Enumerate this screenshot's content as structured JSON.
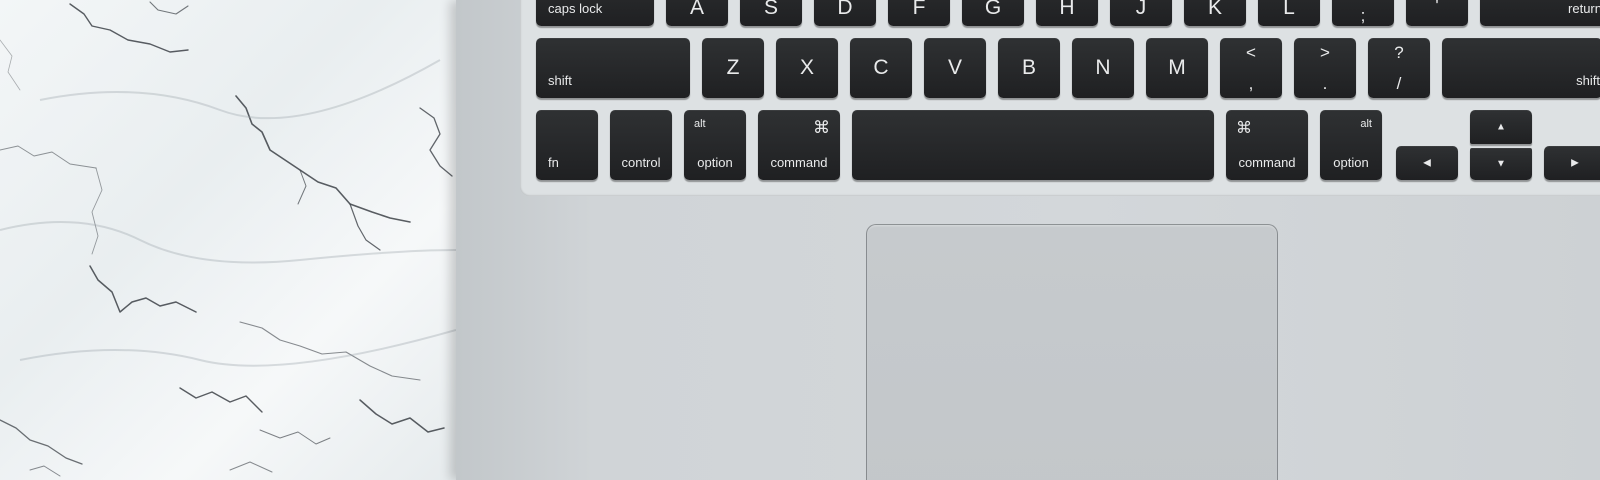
{
  "keyboard": {
    "row_top": {
      "caps_lock": "caps lock",
      "letters": [
        "A",
        "S",
        "D",
        "F",
        "G",
        "H",
        "J",
        "K",
        "L"
      ],
      "semicolon_bottom": ";",
      "quote_bottom": "'",
      "return": "return"
    },
    "row_shift": {
      "shift_left": "shift",
      "letters": [
        "Z",
        "X",
        "C",
        "V",
        "B",
        "N",
        "M"
      ],
      "comma_top": "<",
      "comma_bottom": ",",
      "period_top": ">",
      "period_bottom": ".",
      "slash_top": "?",
      "slash_bottom": "/",
      "shift_right": "shift"
    },
    "row_bottom": {
      "fn": "fn",
      "control": "control",
      "option_left_alt": "alt",
      "option_left": "option",
      "command_left_symbol": "⌘",
      "command_left": "command",
      "command_right_symbol": "⌘",
      "command_right": "command",
      "option_right_alt": "alt",
      "option_right": "option",
      "arrow_left": "◀",
      "arrow_up": "▲",
      "arrow_down": "▼",
      "arrow_right": "▶"
    }
  },
  "colors": {
    "key": "#232527",
    "key_text": "#e9eaeb",
    "aluminum": "#d0d4d7",
    "marble": "#eef2f3",
    "marble_vein": "#4a4f55"
  }
}
